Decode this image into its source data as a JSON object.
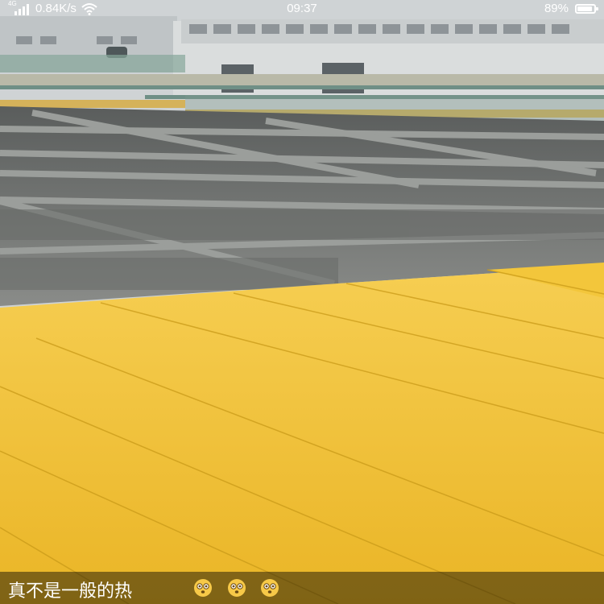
{
  "status_bar": {
    "network_tag": "4G",
    "network_speed": "0.84K/s",
    "time": "09:37",
    "battery_percent": "89%",
    "battery_level": 0.89,
    "icons": [
      "signal-icon",
      "wifi-icon",
      "battery-icon"
    ]
  },
  "caption": {
    "text": "真不是一般的热",
    "emoji_icon": "dizzy-face-emoji"
  },
  "colors": {
    "panel_yellow": "#f2c12e",
    "concrete": "#7f8383",
    "building": "#d9dcdc",
    "railing": "#6f8f86",
    "pipe": "#d5b25a"
  }
}
